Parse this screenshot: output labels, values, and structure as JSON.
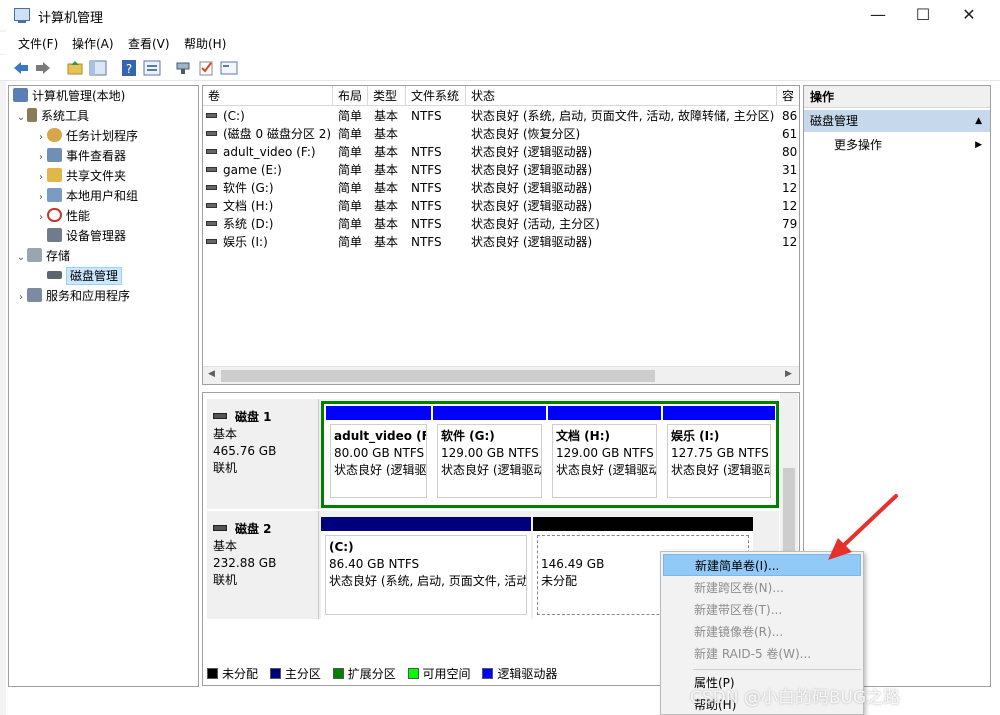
{
  "window": {
    "title": "计算机管理",
    "min_glyph": "—",
    "max_glyph": "☐",
    "close_glyph": "✕"
  },
  "menu": [
    "文件(F)",
    "操作(A)",
    "查看(V)",
    "帮助(H)"
  ],
  "toolbar_icons": [
    "back-arrow-icon",
    "forward-arrow-icon",
    "up-folder-icon",
    "show-hide-tree-icon",
    "help-icon",
    "properties-icon",
    "connect-icon",
    "check-icon",
    "console-icon"
  ],
  "tree": [
    {
      "label": "计算机管理(本地)",
      "arrow": "",
      "icon": "computer-management-icon",
      "color": "#5b7fb5"
    },
    {
      "label": "系统工具",
      "arrow": "⌄",
      "icon": "system-tools-icon",
      "color": "#8a7a5a"
    },
    {
      "label": "任务计划程序",
      "arrow": "›",
      "icon": "task-scheduler-icon",
      "color": "#d9a54a"
    },
    {
      "label": "事件查看器",
      "arrow": "›",
      "icon": "event-viewer-icon",
      "color": "#6f8fb8"
    },
    {
      "label": "共享文件夹",
      "arrow": "›",
      "icon": "shared-folders-icon",
      "color": "#e0b84a"
    },
    {
      "label": "本地用户和组",
      "arrow": "›",
      "icon": "local-users-icon",
      "color": "#7a9bc4"
    },
    {
      "label": "性能",
      "arrow": "›",
      "icon": "performance-icon",
      "color": "#c0392b"
    },
    {
      "label": "设备管理器",
      "arrow": "",
      "icon": "device-manager-icon",
      "color": "#707c8c"
    },
    {
      "label": "存储",
      "arrow": "⌄",
      "icon": "storage-icon",
      "color": "#9aa5b2"
    },
    {
      "label": "磁盘管理",
      "arrow": "",
      "icon": "disk-management-icon",
      "color": "#5d6670"
    },
    {
      "label": "服务和应用程序",
      "arrow": "›",
      "icon": "services-apps-icon",
      "color": "#7d8ba0"
    }
  ],
  "volume_list": {
    "columns": [
      "卷",
      "布局",
      "类型",
      "文件系统",
      "状态",
      "容"
    ],
    "rows": [
      {
        "name": "(C:)",
        "layout": "简单",
        "type": "基本",
        "fs": "NTFS",
        "status": "状态良好 (系统, 启动, 页面文件, 活动, 故障转储, 主分区)",
        "cap": "86"
      },
      {
        "name": "(磁盘 0 磁盘分区 2)",
        "layout": "简单",
        "type": "基本",
        "fs": "",
        "status": "状态良好 (恢复分区)",
        "cap": "61"
      },
      {
        "name": "adult_video (F:)",
        "layout": "简单",
        "type": "基本",
        "fs": "NTFS",
        "status": "状态良好 (逻辑驱动器)",
        "cap": "80"
      },
      {
        "name": "game (E:)",
        "layout": "简单",
        "type": "基本",
        "fs": "NTFS",
        "status": "状态良好 (逻辑驱动器)",
        "cap": "31"
      },
      {
        "name": "软件 (G:)",
        "layout": "简单",
        "type": "基本",
        "fs": "NTFS",
        "status": "状态良好 (逻辑驱动器)",
        "cap": "12"
      },
      {
        "name": "文档 (H:)",
        "layout": "简单",
        "type": "基本",
        "fs": "NTFS",
        "status": "状态良好 (逻辑驱动器)",
        "cap": "12"
      },
      {
        "name": "系统 (D:)",
        "layout": "简单",
        "type": "基本",
        "fs": "NTFS",
        "status": "状态良好 (活动, 主分区)",
        "cap": "79"
      },
      {
        "name": "娱乐 (I:)",
        "layout": "简单",
        "type": "基本",
        "fs": "NTFS",
        "status": "状态良好 (逻辑驱动器)",
        "cap": "12"
      }
    ]
  },
  "disks": [
    {
      "name": "磁盘 1",
      "type": "基本",
      "size": "465.76 GB",
      "status": "联机",
      "partitions": [
        {
          "name": "adult_video (F",
          "size": "80.00 GB NTFS",
          "status": "状态良好 (逻辑驱",
          "bar_color": "#0000ff",
          "hatched": false
        },
        {
          "name": "软件 (G:)",
          "size": "129.00 GB NTFS",
          "status": "状态良好 (逻辑驱动",
          "bar_color": "#0000ff",
          "hatched": false
        },
        {
          "name": "文档 (H:)",
          "size": "129.00 GB NTFS",
          "status": "状态良好 (逻辑驱动",
          "bar_color": "#0000ff",
          "hatched": false
        },
        {
          "name": "娱乐 (I:)",
          "size": "127.75 GB NTFS",
          "status": "状态良好 (逻辑驱动",
          "bar_color": "#0000ff",
          "hatched": false
        }
      ]
    },
    {
      "name": "磁盘 2",
      "type": "基本",
      "size": "232.88 GB",
      "status": "联机",
      "partitions": [
        {
          "name": "(C:)",
          "size": "86.40 GB NTFS",
          "status": "状态良好 (系统, 启动, 页面文件, 活动",
          "bar_color": "#00007f",
          "hatched": false
        },
        {
          "name": "",
          "size": "146.49 GB",
          "status": "未分配",
          "bar_color": "#000000",
          "hatched": true
        }
      ]
    }
  ],
  "legend": [
    {
      "label": "未分配",
      "color": "#000000"
    },
    {
      "label": "主分区",
      "color": "#00007f"
    },
    {
      "label": "扩展分区",
      "color": "#008000"
    },
    {
      "label": "可用空间",
      "color": "#00ff00"
    },
    {
      "label": "逻辑驱动器",
      "color": "#0000ff"
    }
  ],
  "actions": {
    "header": "操作",
    "section": "磁盘管理",
    "more": "更多操作"
  },
  "context_menu": {
    "items": [
      {
        "label": "新建简单卷(I)...",
        "enabled": true,
        "highlight": true
      },
      {
        "label": "新建跨区卷(N)...",
        "enabled": false,
        "highlight": false
      },
      {
        "label": "新建带区卷(T)...",
        "enabled": false,
        "highlight": false
      },
      {
        "label": "新建镜像卷(R)...",
        "enabled": false,
        "highlight": false
      },
      {
        "label": "新建 RAID-5 卷(W)...",
        "enabled": false,
        "highlight": false
      },
      {
        "label": "属性(P)",
        "enabled": true,
        "highlight": false
      },
      {
        "label": "帮助(H)",
        "enabled": true,
        "highlight": false
      }
    ]
  },
  "watermark": "CSDN @小白的码BUG之路",
  "colors": {
    "annotation_arrow": "#e8302a",
    "selected_extended_border": "#008000"
  }
}
